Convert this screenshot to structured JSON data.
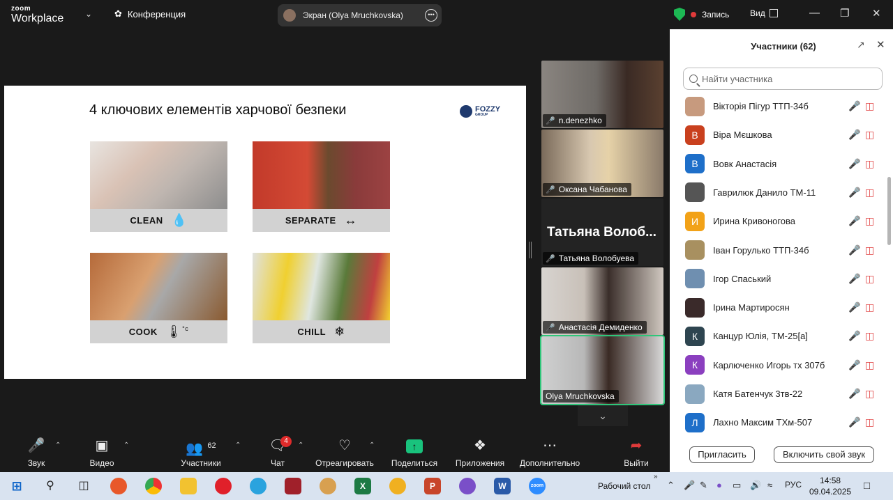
{
  "topbar": {
    "logo_line1": "zoom",
    "logo_line2": "Workplace",
    "conference": "Конференция",
    "screen_share": "Экран (Olya Mruchkovska)",
    "record": "Запись",
    "view": "Вид"
  },
  "slide": {
    "title": "4 ключових елементів харчової безпеки",
    "brand": "FOZZY",
    "brand_sub": "GROUP",
    "tiles": [
      {
        "label": "CLEAN",
        "icon": "water-drop-icon"
      },
      {
        "label": "SEPARATE",
        "icon": "separate-arrows-icon"
      },
      {
        "label": "COOK",
        "icon": "thermometer-icon",
        "icon_text": "°c"
      },
      {
        "label": "CHILL",
        "icon": "snowflake-icon"
      }
    ]
  },
  "videos": [
    {
      "name": "n.denezhko"
    },
    {
      "name": "Оксана Чабанова"
    },
    {
      "name": "Татьяна Волобуева",
      "big": "Татьяна  Волоб..."
    },
    {
      "name": "Анастасія Демиденко"
    },
    {
      "name": "Olya Mruchkovska"
    }
  ],
  "panel": {
    "title": "Участники (62)",
    "search_placeholder": "Найти участника",
    "participants": [
      {
        "name": "Вікторія Пігур ТТП-34б",
        "initial": "",
        "color": "#c79a7e"
      },
      {
        "name": "Віра Мєшкова",
        "initial": "В",
        "color": "#c9401e"
      },
      {
        "name": "Вовк Анастасія",
        "initial": "В",
        "color": "#1e6fc9"
      },
      {
        "name": "Гаврилюк Данило ТМ-11",
        "initial": "",
        "color": "#555555"
      },
      {
        "name": "Ирина Кривоногова",
        "initial": "И",
        "color": "#f2a218"
      },
      {
        "name": "Іван Горулько ТТП-34б",
        "initial": "",
        "color": "#a89060"
      },
      {
        "name": "Ігор Спаський",
        "initial": "",
        "color": "#6f8fb0"
      },
      {
        "name": "Ірина Мартиросян",
        "initial": "",
        "color": "#3a2a2a"
      },
      {
        "name": "Канцур Юлія, ТМ-25[а]",
        "initial": "К",
        "color": "#2e4550"
      },
      {
        "name": "Карлюченко Игорь тх 307б",
        "initial": "К",
        "color": "#8b3fbf"
      },
      {
        "name": "Катя Батенчук 3тв-22",
        "initial": "",
        "color": "#8aa8c0"
      },
      {
        "name": "Лахно Максим ТХм-507",
        "initial": "Л",
        "color": "#1e6fc9"
      }
    ],
    "invite": "Пригласить",
    "unmute": "Включить свой звук"
  },
  "toolbar": {
    "audio": "Звук",
    "video": "Видео",
    "participants": "Участники",
    "participants_count": "62",
    "chat": "Чат",
    "chat_badge": "4",
    "react": "Отреагировать",
    "share": "Поделиться",
    "apps": "Приложения",
    "more": "Дополнительно",
    "leave": "Выйти"
  },
  "taskbar": {
    "desktop": "Рабочий стол",
    "lang": "РУС",
    "time": "14:58",
    "date": "09.04.2025"
  }
}
